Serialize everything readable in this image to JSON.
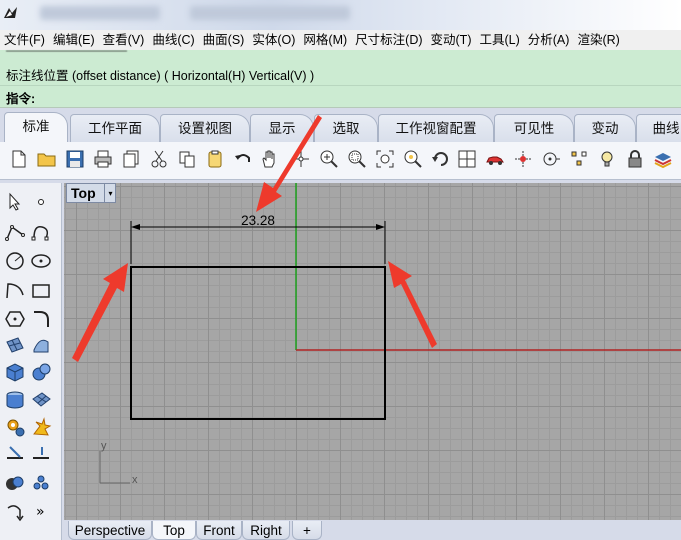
{
  "menu": [
    "文件(F)",
    "编辑(E)",
    "查看(V)",
    "曲线(C)",
    "曲面(S)",
    "实体(O)",
    "网格(M)",
    "尺寸标注(D)",
    "变动(T)",
    "工具(L)",
    "分析(A)",
    "渲染(R)"
  ],
  "command": {
    "prompt_line": "标注线位置 (offset distance) ( Horizontal(H)  Vertical(V) )",
    "label": "指令:"
  },
  "tabs": [
    "标准",
    "工作平面",
    "设置视图",
    "显示",
    "选取",
    "工作视窗配置",
    "可见性",
    "变动",
    "曲线"
  ],
  "toolbar_icons": [
    "new-icon",
    "open-icon",
    "save-icon",
    "print-icon",
    "import-icon",
    "cut-icon",
    "copy-icon",
    "paste-icon",
    "undo-icon",
    "pan-icon",
    "rotate-view-icon",
    "zoom-icon",
    "zoom-window-icon",
    "zoom-extents-icon",
    "zoom-selected-icon",
    "rotate-icon",
    "four-viewports-icon",
    "car-icon",
    "snap-icon",
    "circle-target-icon",
    "select-points-icon",
    "light-icon",
    "lock-icon",
    "layer-icon"
  ],
  "viewport": {
    "name": "Top",
    "dimension_value": "23.28",
    "axis_x": "x",
    "axis_y": "y",
    "colors": {
      "x_axis": "#b02424",
      "y_axis": "#1ea01e",
      "annotation_arrow": "#ee3a2c"
    }
  },
  "viewport_tabs": [
    "Perspective",
    "Top",
    "Front",
    "Right",
    "+"
  ]
}
